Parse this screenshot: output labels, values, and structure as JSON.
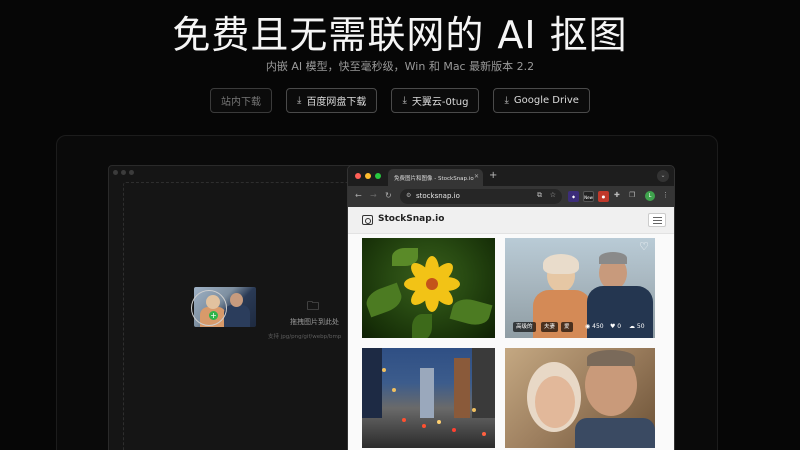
{
  "hero": {
    "title": "免费且无需联网的 AI 抠图",
    "subtitle": "内嵌 AI 模型，快至毫秒级，Win 和 Mac 最新版本 2.2"
  },
  "downloads": [
    {
      "label": "站内下载",
      "icon": "",
      "muted": true
    },
    {
      "label": "百度网盘下载",
      "icon": "download-icon"
    },
    {
      "label": "天翼云-0tug",
      "icon": "download-icon"
    },
    {
      "label": "Google Drive",
      "icon": "download-icon"
    }
  ],
  "app": {
    "drop_label": "拖拽图片到此处",
    "drop_hint": "支持 jpg/png/gif/webp/bmp"
  },
  "browser": {
    "tab_title": "免费图片和图像 - StockSnap.io",
    "url": "stocksnap.io",
    "ext_label_1": "New",
    "avatar_letter": "L"
  },
  "site": {
    "logo": "StockSnap.io",
    "photo2_tags": [
      "高级的",
      "夫妻",
      "爱"
    ],
    "photo2_stats": {
      "views": "450",
      "likes": "0",
      "downloads": "50"
    }
  },
  "colors": {
    "background": "#060606",
    "traffic_red": "#ff5f57",
    "traffic_yellow": "#febc2e",
    "traffic_green": "#28c840",
    "badge_green": "#2fb44a"
  }
}
